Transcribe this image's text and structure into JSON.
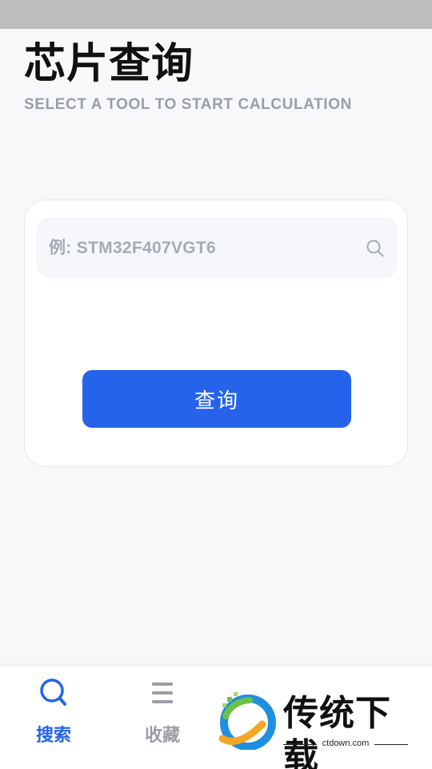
{
  "header": {
    "title": "芯片查询",
    "subtitle": "SELECT A TOOL TO START CALCULATION"
  },
  "search": {
    "placeholder": "例: STM32F407VGT6",
    "value": "",
    "icon": "search-icon",
    "button_label": "查询",
    "button_color": "#2563eb"
  },
  "bottom_nav": {
    "items": [
      {
        "label": "搜索",
        "icon": "search-icon",
        "active": true
      },
      {
        "label": "收藏",
        "icon": "menu-icon",
        "active": false
      }
    ],
    "active_color": "#2563eb",
    "inactive_color": "#9a9ea6"
  },
  "watermark": {
    "text": "传统下载",
    "url": "ctdown.com"
  }
}
